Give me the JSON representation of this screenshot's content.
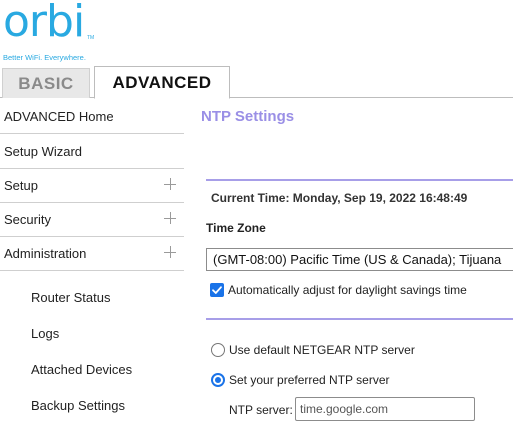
{
  "logo": {
    "word": "orbi",
    "tm": "TM",
    "tagline": "Better WiFi. Everywhere."
  },
  "tabs": {
    "basic": "BASIC",
    "advanced": "ADVANCED",
    "active": "ADVANCED"
  },
  "sidebar": {
    "items": [
      {
        "label": "ADVANCED Home",
        "expandable": false
      },
      {
        "label": "Setup Wizard",
        "expandable": false
      },
      {
        "label": "Setup",
        "expandable": true
      },
      {
        "label": "Security",
        "expandable": true
      },
      {
        "label": "Administration",
        "expandable": true
      }
    ],
    "subitems": [
      {
        "label": "Router Status"
      },
      {
        "label": "Logs"
      },
      {
        "label": "Attached Devices"
      },
      {
        "label": "Backup Settings"
      }
    ]
  },
  "main": {
    "title": "NTP Settings",
    "current_time": "Current Time: Monday, Sep 19, 2022 16:48:49",
    "timezone_label": "Time Zone",
    "timezone_value": "(GMT-08:00) Pacific Time (US & Canada); Tijuana",
    "dst_label": "Automatically adjust for daylight savings time",
    "dst_checked": true,
    "radio_default_label": "Use default NETGEAR NTP server",
    "radio_preferred_label": "Set your preferred NTP server",
    "selected_server_option": "preferred",
    "ntp_server_label": "NTP server:",
    "ntp_server_value": "time.google.com"
  },
  "colors": {
    "brand": "#29a9e1",
    "accent": "#9a8fe6",
    "control": "#1a73e8"
  }
}
